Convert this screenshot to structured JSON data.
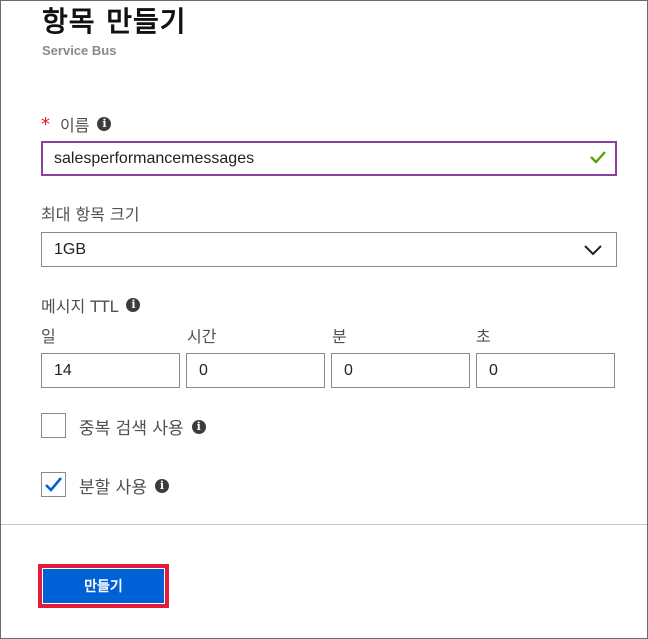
{
  "header": {
    "title": "항목 만들기",
    "subtitle": "Service Bus"
  },
  "form": {
    "name": {
      "required_mark": "*",
      "label": "이름",
      "value": "salesperformancemessages",
      "valid": true
    },
    "max_size": {
      "label": "최대 항목 크기",
      "selected": "1GB"
    },
    "ttl": {
      "label": "메시지 TTL",
      "fields": [
        {
          "label": "일",
          "value": "14"
        },
        {
          "label": "시간",
          "value": "0"
        },
        {
          "label": "분",
          "value": "0"
        },
        {
          "label": "초",
          "value": "0"
        }
      ]
    },
    "duplicate_detection": {
      "label": "중복 검색 사용",
      "checked": false
    },
    "partitioning": {
      "label": "분할 사용",
      "checked": true
    }
  },
  "footer": {
    "create_label": "만들기"
  },
  "colors": {
    "accent": "#0060d6",
    "active_border": "#8c3fa3",
    "highlight": "#e31b3c",
    "valid_check": "#57a300"
  },
  "icons": [
    "info-icon",
    "checkmark-icon",
    "chevron-down-icon",
    "checkbox-check-icon"
  ]
}
